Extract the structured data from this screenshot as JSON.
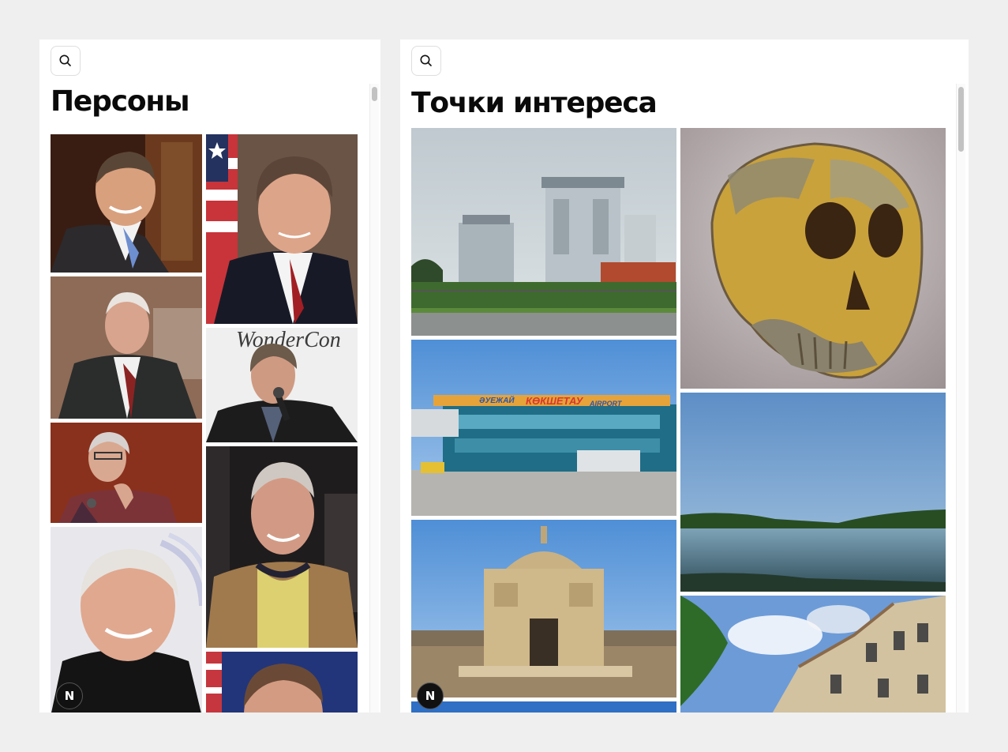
{
  "persons": {
    "title": "Персоны",
    "search_icon": "search-icon",
    "photos": [
      "person-1",
      "person-2",
      "person-3",
      "person-4",
      "person-5",
      "person-6",
      "person-7",
      "person-8"
    ]
  },
  "pois": {
    "title": "Точки интереса",
    "search_icon": "search-icon",
    "photos": [
      "power-plant",
      "skull",
      "airport",
      "lake",
      "mausoleum",
      "city-building"
    ],
    "airport_sign": {
      "left": "ӘУЕЖАЙ",
      "center": "КӨКШЕТАУ",
      "right": "AIRPORT"
    }
  },
  "badge": {
    "label": "N",
    "icon": "nextjs-logo-icon"
  },
  "colors": {
    "background": "#efefef",
    "panel": "#ffffff",
    "title": "#0a0a0a"
  }
}
